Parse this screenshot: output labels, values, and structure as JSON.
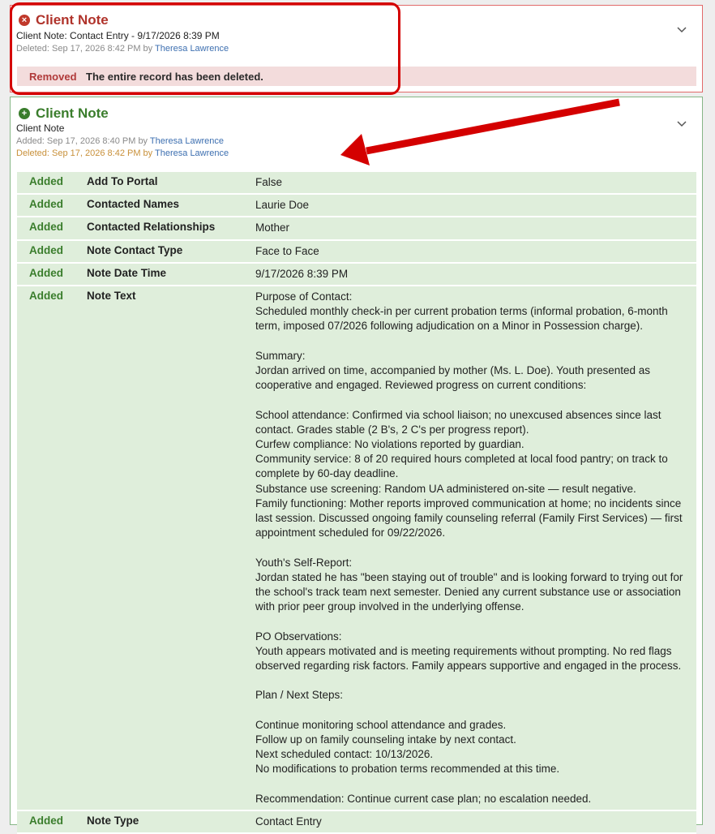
{
  "deleted_card": {
    "title": "Client Note",
    "subtitle": "Client Note: Contact Entry - 9/17/2026 8:39 PM",
    "deleted_prefix": "Deleted: Sep 17, 2026 8:42 PM by",
    "deleted_user": "Theresa Lawrence",
    "status_tag": "Removed",
    "status_message": "The entire record has been deleted."
  },
  "added_card": {
    "title": "Client Note",
    "subtitle": "Client Note",
    "added_prefix": "Added: Sep 17, 2026 8:40 PM by",
    "added_user": "Theresa Lawrence",
    "deleted_prefix": "Deleted: Sep 17, 2026 8:42 PM by",
    "deleted_user": "Theresa Lawrence",
    "rows": [
      {
        "change": "Added",
        "field": "Add To Portal",
        "value": [
          "False"
        ]
      },
      {
        "change": "Added",
        "field": "Contacted Names",
        "value": [
          "Laurie Doe"
        ]
      },
      {
        "change": "Added",
        "field": "Contacted Relationships",
        "value": [
          "Mother"
        ]
      },
      {
        "change": "Added",
        "field": "Note Contact Type",
        "value": [
          "Face to Face"
        ]
      },
      {
        "change": "Added",
        "field": "Note Date Time",
        "value": [
          "9/17/2026 8:39 PM"
        ]
      },
      {
        "change": "Added",
        "field": "Note Text",
        "value": [
          "Purpose of Contact:",
          "Scheduled monthly check-in per current probation terms (informal probation, 6-month",
          "term, imposed 07/2026 following adjudication on a Minor in Possession charge).",
          "",
          "Summary:",
          "Jordan arrived on time, accompanied by mother (Ms. L. Doe). Youth presented as",
          "cooperative and engaged. Reviewed progress on current conditions:",
          "",
          "School attendance: Confirmed via school liaison; no unexcused absences since last",
          "contact. Grades stable (2 B's, 2 C's per progress report).",
          "Curfew compliance: No violations reported by guardian.",
          "Community service: 8 of 20 required hours completed at local food pantry; on track to",
          "complete by 60-day deadline.",
          "Substance use screening: Random UA administered on-site — result negative.",
          "Family functioning: Mother reports improved communication at home; no incidents since",
          "last session. Discussed ongoing family counseling referral (Family First Services) — first",
          "appointment scheduled for 09/22/2026.",
          "",
          "Youth's Self-Report:",
          "Jordan stated he has \"been staying out of trouble\" and is looking forward to trying out for",
          "the school's track team next semester. Denied any current substance use or association",
          "with prior peer group involved in the underlying offense.",
          "",
          "PO Observations:",
          "Youth appears motivated and is meeting requirements without prompting. No red flags",
          "observed regarding risk factors. Family appears supportive and engaged in the process.",
          "",
          "Plan / Next Steps:",
          "",
          "Continue monitoring school attendance and grades.",
          "Follow up on family counseling intake by next contact.",
          "Next scheduled contact: 10/13/2026.",
          "No modifications to probation terms recommended at this time.",
          "",
          "Recommendation: Continue current case plan; no escalation needed."
        ]
      },
      {
        "change": "Added",
        "field": "Note Type",
        "value": [
          "Contact Entry"
        ]
      }
    ]
  },
  "colors": {
    "removed_red": "#b0332b",
    "added_green": "#3a7d2c",
    "link_blue": "#3d6fb0",
    "annotation_red": "#d40000"
  },
  "icons": {
    "deleted_status": "x-circle-icon",
    "added_status": "plus-circle-icon",
    "expand": "chevron-down-icon",
    "annotation": "red-arrow"
  }
}
